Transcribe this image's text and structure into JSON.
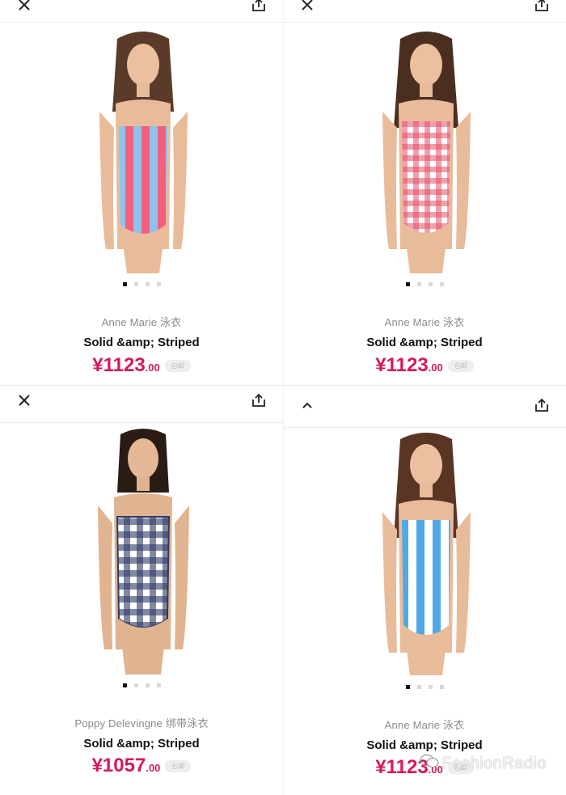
{
  "products": [
    {
      "brand": "Anne Marie 泳衣",
      "name": "Solid &amp; Striped",
      "price_main": "¥1123",
      "price_cents": ".00",
      "tag": "包邮",
      "left_icon": "close-icon",
      "right_icon": "share-icon",
      "swimsuit_colors": [
        "#f4607c",
        "#8cc4ee"
      ],
      "pattern": "vertical-stripes"
    },
    {
      "brand": "Anne Marie 泳衣",
      "name": "Solid &amp; Striped",
      "price_main": "¥1123",
      "price_cents": ".00",
      "tag": "包邮",
      "left_icon": "close-icon",
      "right_icon": "share-icon",
      "swimsuit_colors": [
        "#e4506a",
        "#ffffff"
      ],
      "pattern": "gingham"
    },
    {
      "brand": "Poppy Delevingne 绑带泳衣",
      "name": "Solid &amp; Striped",
      "price_main": "¥1057",
      "price_cents": ".00",
      "tag": "包邮",
      "left_icon": "close-icon",
      "right_icon": "share-icon",
      "swimsuit_colors": [
        "#2e3a66",
        "#ffffff"
      ],
      "pattern": "gingham"
    },
    {
      "brand": "Anne Marie 泳衣",
      "name": "Solid &amp; Striped",
      "price_main": "¥1123",
      "price_cents": ".00",
      "tag": "包邮",
      "left_icon": "chevron-up-icon",
      "right_icon": "share-icon",
      "swimsuit_colors": [
        "#4fa9e6",
        "#ffffff"
      ],
      "pattern": "vertical-stripes"
    }
  ],
  "watermark": "FashionRadio",
  "colors": {
    "price": "#d6185e",
    "brand_text": "#8a8a8a"
  }
}
